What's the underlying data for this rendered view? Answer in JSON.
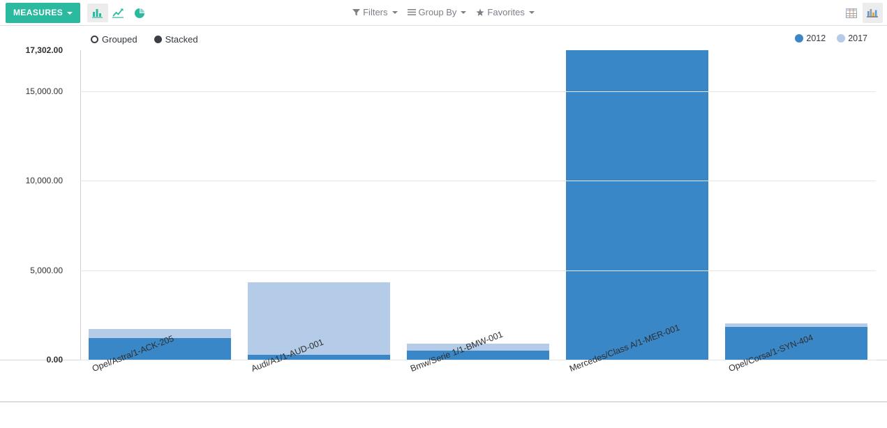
{
  "toolbar": {
    "measures_label": "MEASURES",
    "chart_types": [
      {
        "name": "bar-chart-icon",
        "label": "Bar Chart",
        "active": true
      },
      {
        "name": "line-chart-icon",
        "label": "Line Chart",
        "active": false
      },
      {
        "name": "pie-chart-icon",
        "label": "Pie Chart",
        "active": false
      }
    ],
    "filters_label": "Filters",
    "group_by_label": "Group By",
    "favorites_label": "Favorites",
    "views": [
      {
        "name": "list-view-icon",
        "label": "List",
        "active": false
      },
      {
        "name": "graph-view-icon",
        "label": "Graph",
        "active": true
      }
    ]
  },
  "stack_mode": {
    "grouped_label": "Grouped",
    "grouped_selected": false,
    "stacked_label": "Stacked",
    "stacked_selected": true
  },
  "legend": [
    {
      "label": "2012",
      "color": "#3a87c8"
    },
    {
      "label": "2017",
      "color": "#b4cce8"
    }
  ],
  "chart_data": {
    "type": "bar",
    "stacked": true,
    "title": "",
    "xlabel": "",
    "ylabel": "",
    "ylim": [
      0,
      17302
    ],
    "grid": true,
    "legend_position": "top-right",
    "ytick_labels": [
      "17,302.00",
      "15,000.00",
      "10,000.00",
      "5,000.00",
      "0.00"
    ],
    "ytick_values": [
      17302,
      15000,
      10000,
      5000,
      0
    ],
    "categories": [
      "Opel/Astra/1-ACK-205",
      "Audi/A1/1-AUD-001",
      "Bmw/Serie 1/1-BMW-001",
      "Mercedes/Class A/1-MER-001",
      "Opel/Corsa/1-SYN-404"
    ],
    "series": [
      {
        "name": "2012",
        "color": "#3a87c8",
        "values": [
          1210,
          270,
          510,
          17302,
          1830
        ]
      },
      {
        "name": "2017",
        "color": "#b4cce8",
        "values": [
          510,
          4060,
          390,
          0,
          200
        ]
      }
    ],
    "totals": [
      1720,
      4330,
      900,
      17302,
      2030
    ]
  }
}
